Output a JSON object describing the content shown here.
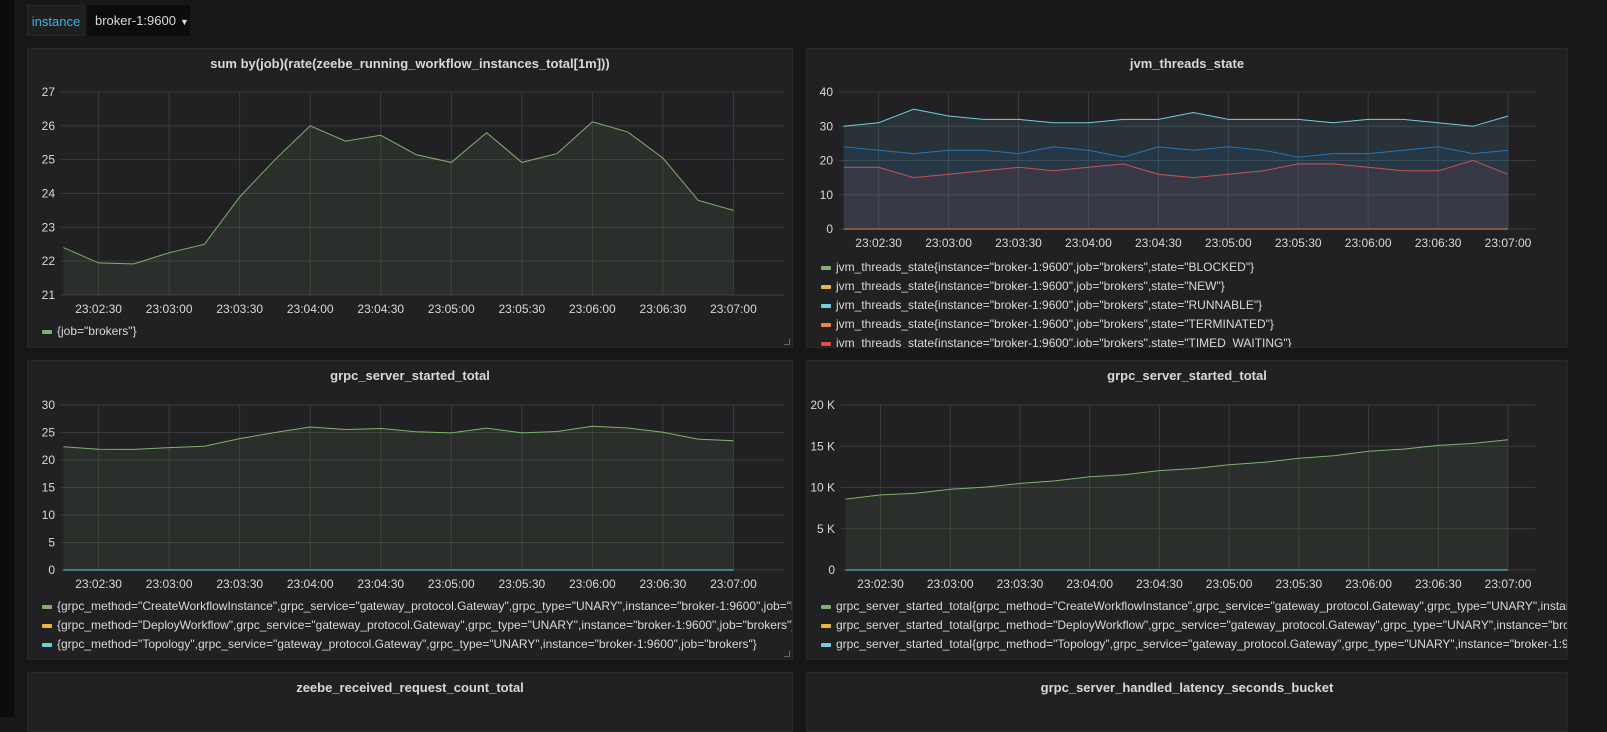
{
  "variables": {
    "label": "instance",
    "value": "broker-1:9600",
    "caret_icon": "caret-down-icon"
  },
  "chart_data": [
    {
      "type": "line",
      "title": "sum by(job)(rate(zeebe_running_workflow_instances_total[1m]))",
      "x": [
        "23:02:15",
        "23:02:30",
        "23:02:45",
        "23:03:00",
        "23:03:15",
        "23:03:30",
        "23:03:45",
        "23:04:00",
        "23:04:15",
        "23:04:30",
        "23:04:45",
        "23:05:00",
        "23:05:15",
        "23:05:30",
        "23:05:45",
        "23:06:00",
        "23:06:15",
        "23:06:30",
        "23:06:45",
        "23:07:00"
      ],
      "xlim": [
        "23:02:14",
        "23:07:13"
      ],
      "xticks": [
        "23:02:30",
        "23:03:00",
        "23:03:30",
        "23:04:00",
        "23:04:30",
        "23:05:00",
        "23:05:30",
        "23:06:00",
        "23:06:30",
        "23:07:00"
      ],
      "ylim": [
        21,
        27
      ],
      "yticks": [
        {
          "v": 21,
          "label": "21"
        },
        {
          "v": 22,
          "label": "22"
        },
        {
          "v": 23,
          "label": "23"
        },
        {
          "v": 24,
          "label": "24"
        },
        {
          "v": 25,
          "label": "25"
        },
        {
          "v": 26,
          "label": "26"
        },
        {
          "v": 27,
          "label": "27"
        }
      ],
      "grid": true,
      "legend": "bottom",
      "series": [
        {
          "name": "{job=\"brokers\"}",
          "color": "#7eb26d",
          "values": [
            22.4,
            21.95,
            21.92,
            22.25,
            22.5,
            23.9,
            25.0,
            26.0,
            25.55,
            25.72,
            25.15,
            24.92,
            25.8,
            24.92,
            25.18,
            26.12,
            25.82,
            25.05,
            23.8,
            23.5
          ]
        }
      ]
    },
    {
      "type": "line",
      "title": "jvm_threads_state",
      "x": [
        "23:02:15",
        "23:02:30",
        "23:02:45",
        "23:03:00",
        "23:03:15",
        "23:03:30",
        "23:03:45",
        "23:04:00",
        "23:04:15",
        "23:04:30",
        "23:04:45",
        "23:05:00",
        "23:05:15",
        "23:05:30",
        "23:05:45",
        "23:06:00",
        "23:06:15",
        "23:06:30",
        "23:06:45",
        "23:07:00"
      ],
      "xlim": [
        "23:02:13",
        "23:07:03"
      ],
      "xticks": [
        "23:02:30",
        "23:03:00",
        "23:03:30",
        "23:04:00",
        "23:04:30",
        "23:05:00",
        "23:05:30",
        "23:06:00",
        "23:06:30",
        "23:07:00"
      ],
      "ylim": [
        0,
        40
      ],
      "yticks": [
        {
          "v": 0,
          "label": "0"
        },
        {
          "v": 10,
          "label": "10"
        },
        {
          "v": 20,
          "label": "20"
        },
        {
          "v": 30,
          "label": "30"
        },
        {
          "v": 40,
          "label": "40"
        }
      ],
      "grid": true,
      "legend": "bottom",
      "series": [
        {
          "name": "jvm_threads_state{instance=\"broker-1:9600\",job=\"brokers\",state=\"BLOCKED\"}",
          "color": "#7eb26d",
          "values": [
            0,
            0,
            0,
            0,
            0,
            0,
            0,
            0,
            0,
            0,
            0,
            0,
            0,
            0,
            0,
            0,
            0,
            0,
            0,
            0
          ]
        },
        {
          "name": "jvm_threads_state{instance=\"broker-1:9600\",job=\"brokers\",state=\"NEW\"}",
          "color": "#eab839",
          "values": [
            0,
            0,
            0,
            0,
            0,
            0,
            0,
            0,
            0,
            0,
            0,
            0,
            0,
            0,
            0,
            0,
            0,
            0,
            0,
            0
          ]
        },
        {
          "name": "jvm_threads_state{instance=\"broker-1:9600\",job=\"brokers\",state=\"RUNNABLE\"}",
          "color": "#6ed0e0",
          "values": [
            30,
            31,
            35,
            33,
            32,
            32,
            31,
            31,
            32,
            32,
            34,
            32,
            32,
            32,
            31,
            32,
            32,
            31,
            30,
            33
          ]
        },
        {
          "name": "jvm_threads_state{instance=\"broker-1:9600\",job=\"brokers\",state=\"TERMINATED\"}",
          "color": "#ef843c",
          "values": [
            0,
            0,
            0,
            0,
            0,
            0,
            0,
            0,
            0,
            0,
            0,
            0,
            0,
            0,
            0,
            0,
            0,
            0,
            0,
            0
          ]
        },
        {
          "name": "jvm_threads_state{instance=\"broker-1:9600\",job=\"brokers\",state=\"TIMED_WAITING\"}",
          "color": "#e24d42",
          "values": [
            18,
            18,
            15,
            16,
            17,
            18,
            17,
            18,
            19,
            16,
            15,
            16,
            17,
            19,
            19,
            18,
            17,
            17,
            20,
            16
          ]
        },
        {
          "color": "#1f78c1",
          "values": [
            24,
            23,
            22,
            23,
            23,
            22,
            24,
            23,
            21,
            24,
            23,
            24,
            23,
            21,
            22,
            22,
            23,
            24,
            22,
            23
          ]
        }
      ]
    },
    {
      "type": "line",
      "title": "grpc_server_started_total",
      "x": [
        "23:02:15",
        "23:02:30",
        "23:02:45",
        "23:03:00",
        "23:03:15",
        "23:03:30",
        "23:03:45",
        "23:04:00",
        "23:04:15",
        "23:04:30",
        "23:04:45",
        "23:05:00",
        "23:05:15",
        "23:05:30",
        "23:05:45",
        "23:06:00",
        "23:06:15",
        "23:06:30",
        "23:06:45",
        "23:07:00"
      ],
      "xlim": [
        "23:02:14",
        "23:07:13"
      ],
      "xticks": [
        "23:02:30",
        "23:03:00",
        "23:03:30",
        "23:04:00",
        "23:04:30",
        "23:05:00",
        "23:05:30",
        "23:06:00",
        "23:06:30",
        "23:07:00"
      ],
      "ylim": [
        0,
        30
      ],
      "yticks": [
        {
          "v": 0,
          "label": "0"
        },
        {
          "v": 5,
          "label": "5"
        },
        {
          "v": 10,
          "label": "10"
        },
        {
          "v": 15,
          "label": "15"
        },
        {
          "v": 20,
          "label": "20"
        },
        {
          "v": 25,
          "label": "25"
        },
        {
          "v": 30,
          "label": "30"
        }
      ],
      "grid": true,
      "legend": "bottom",
      "series": [
        {
          "name": "{grpc_method=\"CreateWorkflowInstance\",grpc_service=\"gateway_protocol.Gateway\",grpc_type=\"UNARY\",instance=\"broker-1:9600\",job=\"brokers\"}",
          "color": "#7eb26d",
          "values": [
            22.4,
            21.95,
            21.92,
            22.25,
            22.5,
            23.9,
            25.0,
            26.0,
            25.55,
            25.72,
            25.15,
            24.92,
            25.8,
            24.92,
            25.18,
            26.12,
            25.82,
            25.05,
            23.8,
            23.5
          ]
        },
        {
          "name": "{grpc_method=\"DeployWorkflow\",grpc_service=\"gateway_protocol.Gateway\",grpc_type=\"UNARY\",instance=\"broker-1:9600\",job=\"brokers\"}",
          "color": "#eab839",
          "values": [
            0,
            0,
            0,
            0,
            0,
            0,
            0,
            0,
            0,
            0,
            0,
            0,
            0,
            0,
            0,
            0,
            0,
            0,
            0,
            0
          ]
        },
        {
          "name": "{grpc_method=\"Topology\",grpc_service=\"gateway_protocol.Gateway\",grpc_type=\"UNARY\",instance=\"broker-1:9600\",job=\"brokers\"}",
          "color": "#6ed0e0",
          "values": [
            0,
            0,
            0,
            0,
            0,
            0,
            0,
            0,
            0,
            0,
            0,
            0,
            0,
            0,
            0,
            0,
            0,
            0,
            0,
            0
          ]
        }
      ]
    },
    {
      "type": "line",
      "title": "grpc_server_started_total",
      "x": [
        "23:02:15",
        "23:02:30",
        "23:02:45",
        "23:03:00",
        "23:03:15",
        "23:03:30",
        "23:03:45",
        "23:04:00",
        "23:04:15",
        "23:04:30",
        "23:04:45",
        "23:05:00",
        "23:05:15",
        "23:05:30",
        "23:05:45",
        "23:06:00",
        "23:06:15",
        "23:06:30",
        "23:06:45",
        "23:07:00"
      ],
      "xlim": [
        "23:02:13",
        "23:07:03"
      ],
      "xticks": [
        "23:02:30",
        "23:03:00",
        "23:03:30",
        "23:04:00",
        "23:04:30",
        "23:05:00",
        "23:05:30",
        "23:06:00",
        "23:06:30",
        "23:07:00"
      ],
      "ylim": [
        0,
        20000
      ],
      "yticks": [
        {
          "v": 0,
          "label": "0"
        },
        {
          "v": 5000,
          "label": "5 K"
        },
        {
          "v": 10000,
          "label": "10 K"
        },
        {
          "v": 15000,
          "label": "15 K"
        },
        {
          "v": 20000,
          "label": "20 K"
        }
      ],
      "grid": true,
      "legend": "bottom",
      "series": [
        {
          "name": "grpc_server_started_total{grpc_method=\"CreateWorkflowInstance\",grpc_service=\"gateway_protocol.Gateway\",grpc_type=\"UNARY\",instance=\"broker-1:9600\",job=\"brokers\"}",
          "color": "#7eb26d",
          "values": [
            8600,
            9100,
            9300,
            9800,
            10050,
            10500,
            10800,
            11300,
            11550,
            12050,
            12300,
            12750,
            13050,
            13550,
            13850,
            14400,
            14650,
            15100,
            15350,
            15800
          ]
        },
        {
          "name": "grpc_server_started_total{grpc_method=\"DeployWorkflow\",grpc_service=\"gateway_protocol.Gateway\",grpc_type=\"UNARY\",instance=\"broker-1:9600\",job=\"brokers\"}",
          "color": "#eab839",
          "values": [
            0,
            0,
            0,
            0,
            0,
            0,
            0,
            0,
            0,
            0,
            0,
            0,
            0,
            0,
            0,
            0,
            0,
            0,
            0,
            0
          ]
        },
        {
          "name": "grpc_server_started_total{grpc_method=\"Topology\",grpc_service=\"gateway_protocol.Gateway\",grpc_type=\"UNARY\",instance=\"broker-1:9600\",job=\"brokers\"}",
          "color": "#6ed0e0",
          "values": [
            0,
            0,
            0,
            0,
            0,
            0,
            0,
            0,
            0,
            0,
            0,
            0,
            0,
            0,
            0,
            0,
            0,
            0,
            0,
            0
          ]
        }
      ]
    }
  ],
  "bottom_panels": [
    {
      "title": "zeebe_received_request_count_total"
    },
    {
      "title": "grpc_server_handled_latency_seconds_bucket"
    }
  ]
}
